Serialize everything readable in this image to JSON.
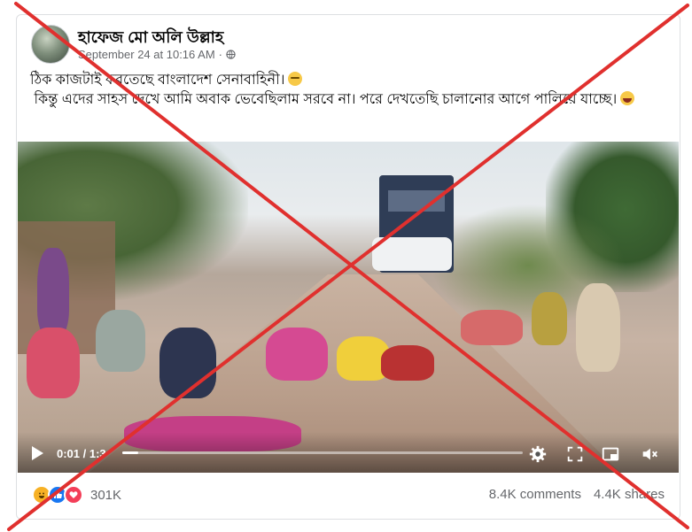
{
  "post": {
    "author": "হাফেজ মো অলি উল্লাহ",
    "timestamp": "September 24 at 10:16 AM",
    "separator": "·",
    "privacy_icon": "globe-icon",
    "text_line1": "ঠিক কাজটাই করতেছে বাংলাদেশ সেনাবাহিনী।",
    "text_line2": "কিন্তু এদের সাহস দেখে আমি অবাক ভেবেছিলাম সরবে না। পরে দেখতেছি চালানোর আগে পালিয়ে যাচ্ছে।",
    "emoji1": "smirk-emoji",
    "emoji2": "rofl-emoji"
  },
  "video": {
    "time": "0:01 / 1:3",
    "progress": 0.01,
    "icons": [
      "play-icon",
      "gear-icon",
      "fullscreen-icon",
      "pip-icon",
      "volume-muted-icon"
    ]
  },
  "footer": {
    "reactions": [
      "haha",
      "like",
      "love"
    ],
    "reaction_count": "301K",
    "comments": "8.4K comments",
    "shares": "4.4K shares"
  },
  "colors": {
    "overlay_cross": "#e0302e",
    "meta_text": "#65676b",
    "like_blue": "#1877f2",
    "love_red": "#f33e58",
    "haha_yellow": "#f7b125"
  }
}
